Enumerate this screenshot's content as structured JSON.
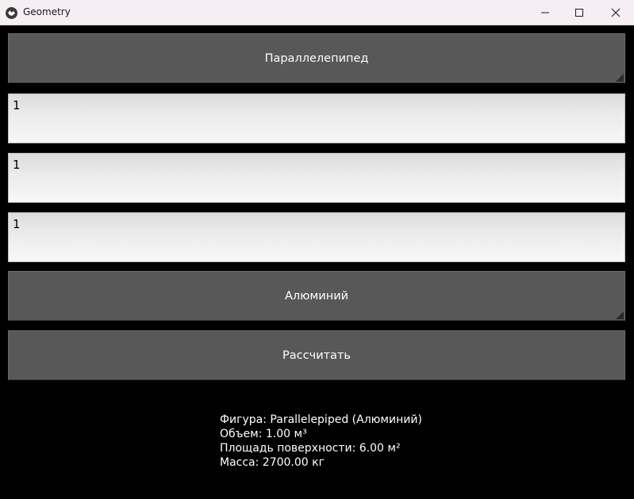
{
  "window": {
    "title": "Geometry"
  },
  "shape_spinner": {
    "label": "Параллелепипед"
  },
  "inputs": [
    "1",
    "1",
    "1"
  ],
  "material_spinner": {
    "label": "Алюминий"
  },
  "calculate_button": {
    "label": "Рассчитать"
  },
  "results": {
    "figure": "Фигура: Parallelepiped (Алюминий)",
    "volume": "Объем: 1.00 м³",
    "surface_area": "Площадь поверхности: 6.00 м²",
    "mass": "Масса: 2700.00 кг"
  }
}
